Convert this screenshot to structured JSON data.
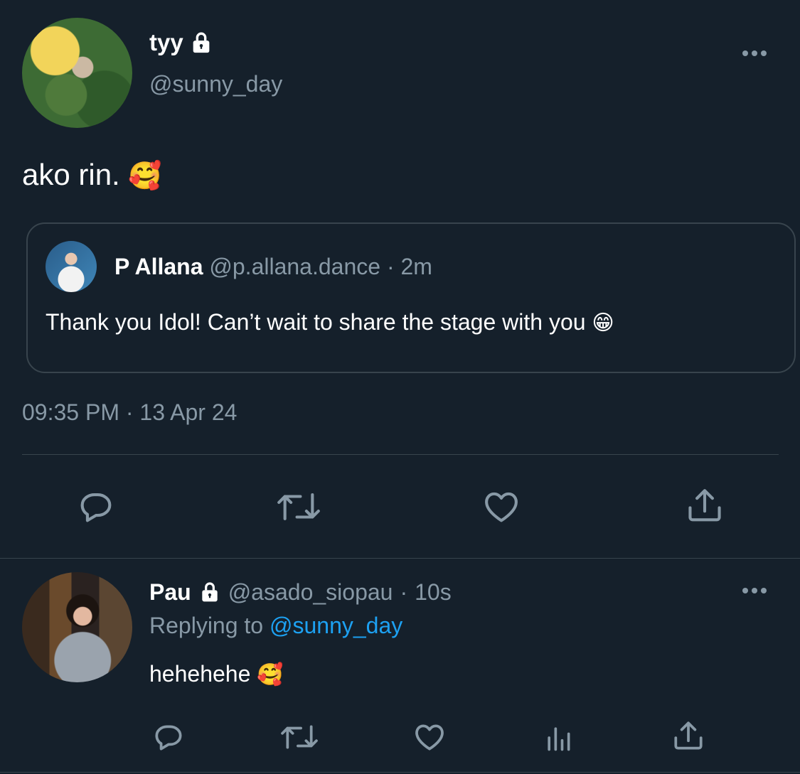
{
  "main_tweet": {
    "display_name": "tyy",
    "handle": "@sunny_day",
    "text": "ako rin.",
    "emoji": "🥰",
    "timestamp": "09:35 PM · 13 Apr 24",
    "more_icon": "more-horizontal-icon",
    "protected_icon": "lock-icon"
  },
  "quoted_tweet": {
    "display_name": "P Allana",
    "handle": "@p.allana.dance",
    "separator": "·",
    "time": "2m",
    "text": "Thank you Idol! Can’t wait to share the stage with you",
    "emoji": "😁"
  },
  "main_actions": [
    "reply-icon",
    "retweet-icon",
    "like-icon",
    "share-icon"
  ],
  "reply_tweet": {
    "display_name": "Pau",
    "handle": "@asado_siopau",
    "separator": "·",
    "time": "10s",
    "replying_prefix": "Replying to",
    "replying_to": "@sunny_day",
    "text": "hehehehe",
    "emoji": "🥰",
    "more_icon": "more-horizontal-icon",
    "protected_icon": "lock-icon"
  },
  "reply_actions": [
    "reply-icon",
    "retweet-icon",
    "like-icon",
    "analytics-icon",
    "share-icon"
  ],
  "colors": {
    "background": "#15202b",
    "text": "#ffffff",
    "muted": "#8899a6",
    "link": "#1da1f2",
    "divider": "#38444d"
  }
}
